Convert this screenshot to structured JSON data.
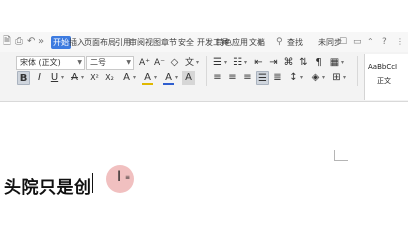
{
  "quick_access": {
    "save_icon": "save-icon",
    "undo_icon": "undo-icon",
    "more": "»"
  },
  "menu_tabs": [
    {
      "label": "开始",
      "active": true
    },
    {
      "label": "插入",
      "active": false
    },
    {
      "label": "页面布局",
      "active": false
    },
    {
      "label": "引用",
      "active": false
    },
    {
      "label": "审阅",
      "active": false
    },
    {
      "label": "视图",
      "active": false
    },
    {
      "label": "章节",
      "active": false
    },
    {
      "label": "安全",
      "active": false
    },
    {
      "label": "开发工具",
      "active": false
    },
    {
      "label": "特色应用",
      "active": false
    },
    {
      "label": "文档",
      "active": false
    }
  ],
  "right_menu": {
    "search_label": "查找",
    "unsynced_label": "未同步",
    "help_label": "?"
  },
  "font": {
    "name": "宋体 (正文)",
    "size": "二号"
  },
  "format": {
    "bold": "B",
    "italic": "I",
    "underline": "U",
    "strikethrough": "A",
    "superscript": "X²",
    "subscript": "X₂",
    "font_color": "A",
    "highlight": "A",
    "char_shading": "A",
    "grow_font": "A⁺",
    "shrink_font": "A⁻",
    "clear_format": "◇",
    "phonetic": "文"
  },
  "styles": {
    "preview": "AaBbCcI",
    "label": "正文"
  },
  "colors": {
    "accent": "#3d7be0",
    "font_color_bar": "#e02020",
    "highlight_bar": "#2f5ecf"
  },
  "document": {
    "visible_text": "头院只是创"
  }
}
